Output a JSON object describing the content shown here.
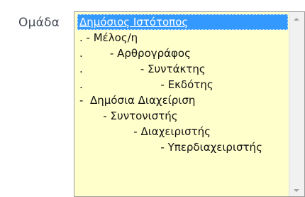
{
  "field": {
    "label": "Ομάδα"
  },
  "group_select": {
    "selected_index": 0,
    "options": [
      {
        "label": "Δημόσιος Ιστότοπος"
      },
      {
        "label": ". - Μέλος/η"
      },
      {
        "label": ".        - Αρθρογράφος"
      },
      {
        "label": ".                 - Συντάκτης"
      },
      {
        "label": ".                       - Εκδότης"
      },
      {
        "label": "-  Δημόσια Διαχείριση"
      },
      {
        "label": "       - Συντονιστής"
      },
      {
        "label": "                - Διαχειριστής"
      },
      {
        "label": "                        - Υπερδιαχειριστής"
      }
    ]
  },
  "icons": {
    "scroll_up": "chevron-up-icon",
    "scroll_down": "chevron-down-icon"
  },
  "colors": {
    "list_background": "#ffffcc",
    "selection_background": "#3399ff",
    "selection_text": "#ffffff",
    "label_text": "#444a55"
  }
}
